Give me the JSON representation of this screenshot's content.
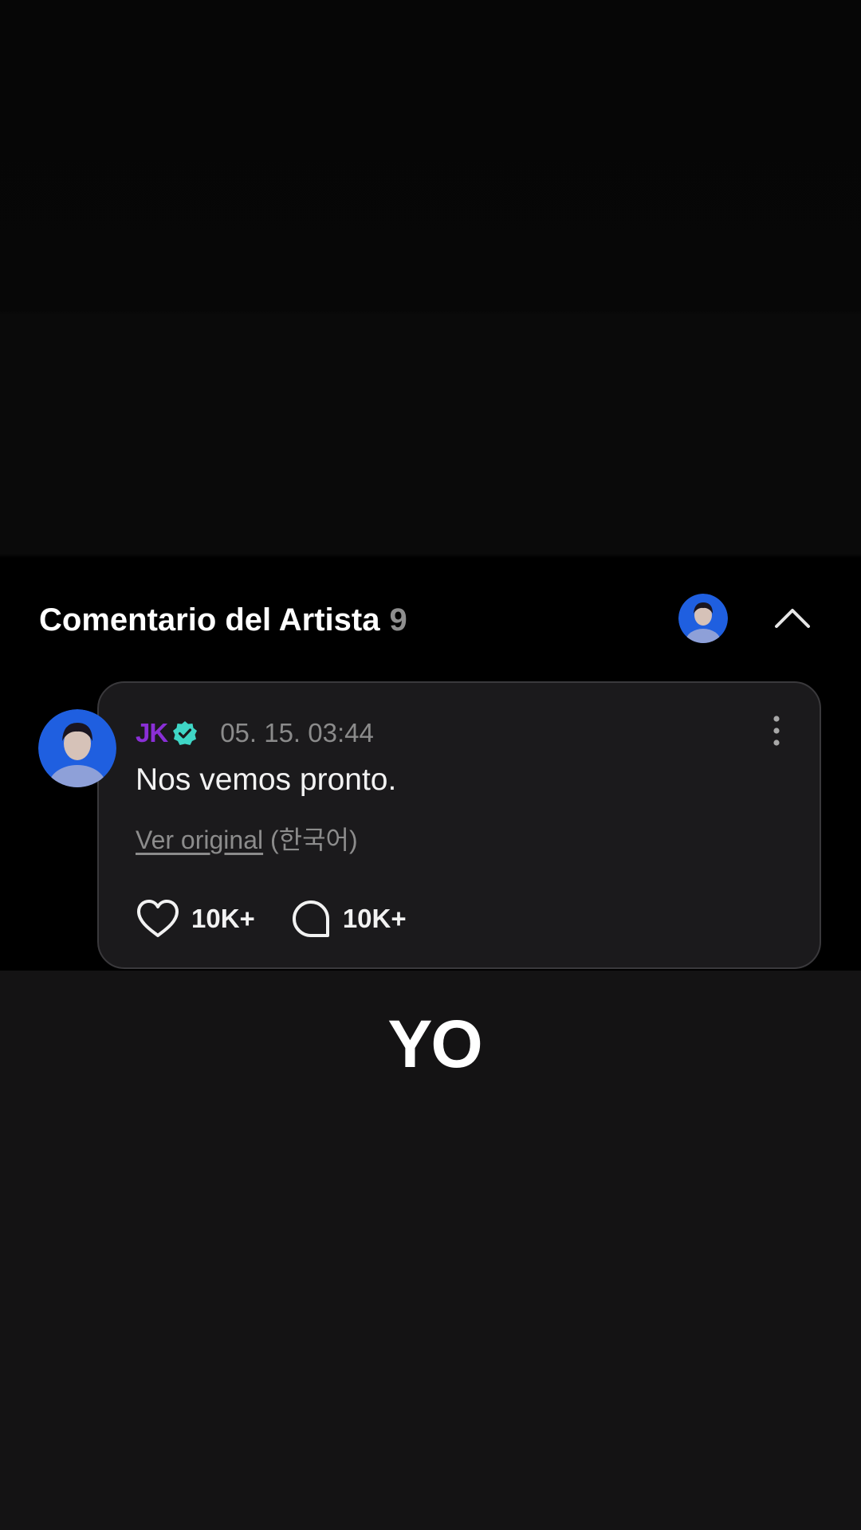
{
  "section": {
    "title": "Comentario del Artista",
    "count": "9",
    "header_avatar_icon": "artist-avatar-icon",
    "collapse_icon": "chevron-up-icon"
  },
  "comment": {
    "author": "JK",
    "verified_icon": "verified-badge-icon",
    "timestamp": "05. 15. 03:44",
    "text": "Nos vemos pronto.",
    "translate_link": "Ver original",
    "language": "(한국어)",
    "more_icon": "more-vertical-icon",
    "likes": "10K+",
    "replies": "10K+",
    "like_icon": "heart-icon",
    "reply_icon": "comment-bubble-icon"
  },
  "caption": "YO",
  "colors": {
    "author": "#8a2fd6",
    "verified": "#3fd6c6",
    "card_bg": "#1b1a1c",
    "card_border": "#3a393c",
    "avatar_blue": "#1f5fe0"
  }
}
